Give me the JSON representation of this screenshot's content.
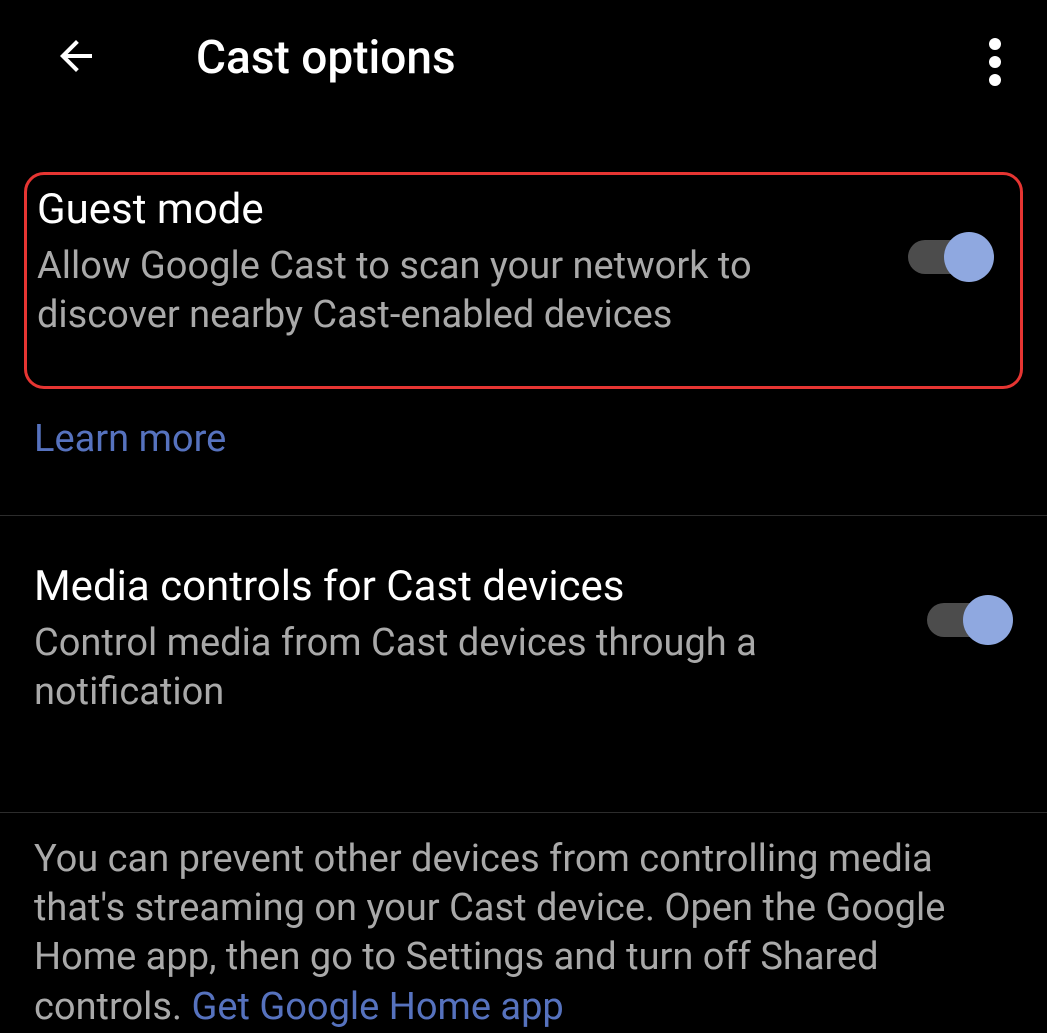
{
  "header": {
    "title": "Cast options"
  },
  "settings": {
    "guestMode": {
      "title": "Guest mode",
      "description": "Allow Google Cast to scan your network to discover nearby Cast-enabled devices",
      "enabled": true,
      "learnMoreLabel": "Learn more"
    },
    "mediaControls": {
      "title": "Media controls for Cast devices",
      "description": "Control media from Cast devices through a notification",
      "enabled": true
    }
  },
  "infoText": {
    "body": "You can prevent other devices from controlling media that's streaming on your Cast device. Open the Google Home app, then go to Settings and turn off Shared controls. ",
    "linkLabel": "Get Google Home app"
  }
}
